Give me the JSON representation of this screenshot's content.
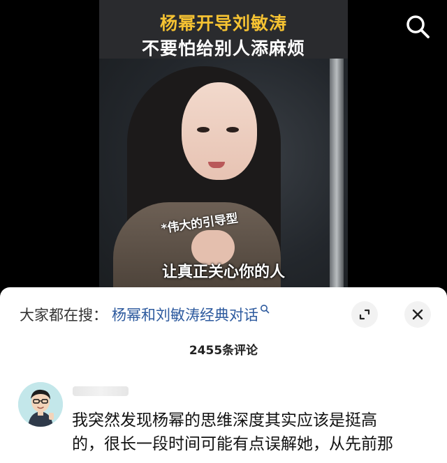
{
  "video": {
    "title_line1": "杨幂开导刘敏涛",
    "title_line2": "不要怕给别人添麻烦",
    "note_text": "*伟大的引导型",
    "subtitle": "让真正关心你的人",
    "search_icon": "search-icon"
  },
  "comments_sheet": {
    "search_prefix": "大家都在搜：",
    "search_query": "杨幂和刘敏涛经典对话",
    "search_query_icon": "search-icon",
    "expand_icon": "expand-icon",
    "close_icon": "close-icon",
    "comment_count": "2455条评论"
  },
  "comment": {
    "avatar_icon": "cartoon-avatar-icon",
    "line1": "我突然发现杨幂的思维深度其实应该是挺高",
    "line2": "的，很长一段时间可能有点误解她，从先前那"
  },
  "colors": {
    "title_yellow": "#f5c232",
    "link_blue": "#2d5a9e",
    "sheet_bg": "#ffffff",
    "button_bg": "#f2f2f2"
  }
}
